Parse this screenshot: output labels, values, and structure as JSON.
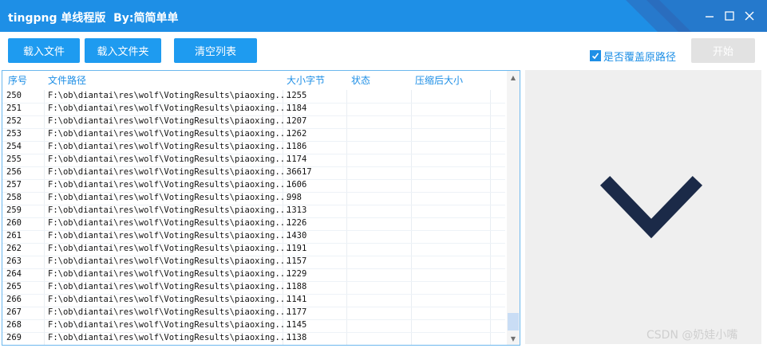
{
  "window": {
    "title": "tingpng 单线程版  By:简简单单",
    "accent_color": "#1e8fe6",
    "controls": [
      "minimize-icon",
      "maximize-icon",
      "close-icon"
    ]
  },
  "toolbar": {
    "load_file_label": "载入文件",
    "load_folder_label": "载入文件夹",
    "clear_list_label": "清空列表",
    "overwrite_label": "是否覆盖原路径",
    "overwrite_checked": true,
    "start_label": "开始"
  },
  "table": {
    "columns": [
      "序号",
      "文件路径",
      "大小字节",
      "状态",
      "压缩后大小"
    ],
    "rows": [
      {
        "id": "250",
        "path": "F:\\ob\\diantai\\res\\wolf\\VotingResults\\piaoxing...",
        "size": "1255",
        "status": "",
        "compressed": ""
      },
      {
        "id": "251",
        "path": "F:\\ob\\diantai\\res\\wolf\\VotingResults\\piaoxing...",
        "size": "1184",
        "status": "",
        "compressed": ""
      },
      {
        "id": "252",
        "path": "F:\\ob\\diantai\\res\\wolf\\VotingResults\\piaoxing...",
        "size": "1207",
        "status": "",
        "compressed": ""
      },
      {
        "id": "253",
        "path": "F:\\ob\\diantai\\res\\wolf\\VotingResults\\piaoxing...",
        "size": "1262",
        "status": "",
        "compressed": ""
      },
      {
        "id": "254",
        "path": "F:\\ob\\diantai\\res\\wolf\\VotingResults\\piaoxing...",
        "size": "1186",
        "status": "",
        "compressed": ""
      },
      {
        "id": "255",
        "path": "F:\\ob\\diantai\\res\\wolf\\VotingResults\\piaoxing...",
        "size": "1174",
        "status": "",
        "compressed": ""
      },
      {
        "id": "256",
        "path": "F:\\ob\\diantai\\res\\wolf\\VotingResults\\piaoxing...",
        "size": "36617",
        "status": "",
        "compressed": ""
      },
      {
        "id": "257",
        "path": "F:\\ob\\diantai\\res\\wolf\\VotingResults\\piaoxing...",
        "size": "1606",
        "status": "",
        "compressed": ""
      },
      {
        "id": "258",
        "path": "F:\\ob\\diantai\\res\\wolf\\VotingResults\\piaoxing...",
        "size": "998",
        "status": "",
        "compressed": ""
      },
      {
        "id": "259",
        "path": "F:\\ob\\diantai\\res\\wolf\\VotingResults\\piaoxing...",
        "size": "1313",
        "status": "",
        "compressed": ""
      },
      {
        "id": "260",
        "path": "F:\\ob\\diantai\\res\\wolf\\VotingResults\\piaoxing...",
        "size": "1226",
        "status": "",
        "compressed": ""
      },
      {
        "id": "261",
        "path": "F:\\ob\\diantai\\res\\wolf\\VotingResults\\piaoxing...",
        "size": "1430",
        "status": "",
        "compressed": ""
      },
      {
        "id": "262",
        "path": "F:\\ob\\diantai\\res\\wolf\\VotingResults\\piaoxing...",
        "size": "1191",
        "status": "",
        "compressed": ""
      },
      {
        "id": "263",
        "path": "F:\\ob\\diantai\\res\\wolf\\VotingResults\\piaoxing...",
        "size": "1157",
        "status": "",
        "compressed": ""
      },
      {
        "id": "264",
        "path": "F:\\ob\\diantai\\res\\wolf\\VotingResults\\piaoxing...",
        "size": "1229",
        "status": "",
        "compressed": ""
      },
      {
        "id": "265",
        "path": "F:\\ob\\diantai\\res\\wolf\\VotingResults\\piaoxing...",
        "size": "1188",
        "status": "",
        "compressed": ""
      },
      {
        "id": "266",
        "path": "F:\\ob\\diantai\\res\\wolf\\VotingResults\\piaoxing...",
        "size": "1141",
        "status": "",
        "compressed": ""
      },
      {
        "id": "267",
        "path": "F:\\ob\\diantai\\res\\wolf\\VotingResults\\piaoxing...",
        "size": "1177",
        "status": "",
        "compressed": ""
      },
      {
        "id": "268",
        "path": "F:\\ob\\diantai\\res\\wolf\\VotingResults\\piaoxing...",
        "size": "1145",
        "status": "",
        "compressed": ""
      },
      {
        "id": "269",
        "path": "F:\\ob\\diantai\\res\\wolf\\VotingResults\\piaoxing...",
        "size": "1138",
        "status": "",
        "compressed": ""
      }
    ],
    "scroll_position": 0.93
  },
  "preview": {
    "icon": "chevron-down-icon",
    "icon_color": "#1b2a48"
  },
  "watermark": "CSDN @奶娃小嘴"
}
